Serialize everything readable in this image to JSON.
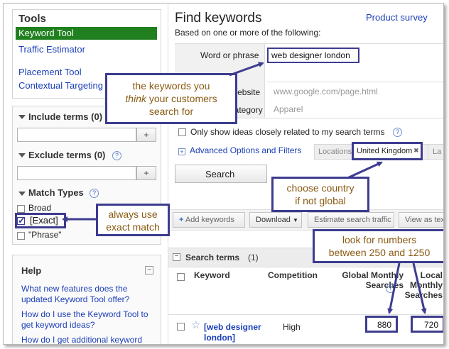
{
  "sidebar": {
    "tools_title": "Tools",
    "items": [
      {
        "label": "Keyword Tool"
      },
      {
        "label": "Traffic Estimator"
      },
      {
        "label": "Placement Tool"
      },
      {
        "label": "Contextual Targeting Tool"
      }
    ],
    "include_terms": "Include terms (0)",
    "exclude_terms": "Exclude terms (0)",
    "match_types": "Match Types",
    "match_options": [
      "Broad",
      "[Exact]",
      "\"Phrase\""
    ],
    "plus": "+",
    "help_title": "Help",
    "help_minus": "−",
    "help_links": [
      "What new features does the updated Keyword Tool offer?",
      "How do I use the Keyword Tool to get keyword ideas?",
      "How do I get additional keyword"
    ]
  },
  "main": {
    "title": "Find keywords",
    "subtitle": "Based on one or more of the following:",
    "product_survey": "Product survey",
    "word_label": "Word or phrase",
    "word_value": "web designer london",
    "website_label": "Website",
    "website_placeholder": "www.google.com/page.html",
    "category_label": "Category",
    "category_value": "Apparel",
    "only_ideas": "Only show ideas closely related to my search terms",
    "advanced": "Advanced Options and Filters",
    "locations": "Locations:",
    "location_chip": "United Kingdom",
    "chip_close": "✖",
    "languages_abbr": "La",
    "search_button": "Search"
  },
  "toolbar": {
    "add_keywords": "Add keywords",
    "download": "Download",
    "estimate": "Estimate search traffic",
    "view_as": "View as text"
  },
  "results": {
    "section_title": "Search terms",
    "section_count": "(1)",
    "columns": [
      "Keyword",
      "Competition",
      "Global Monthly Searches",
      "Local Monthly Searches"
    ],
    "rows": [
      {
        "keyword": "[web designer london]",
        "competition": "High",
        "global": "880",
        "local": "720"
      }
    ]
  },
  "callouts": {
    "think_line1": "the keywords you",
    "think_line2_em": "think",
    "think_line2_rest": "your customers",
    "think_line3": "search for",
    "country_line1": "choose country",
    "country_line2": "if not global",
    "exact_line1": "always use",
    "exact_line2": "exact match",
    "numbers_line1": "look for numbers",
    "numbers_line2": "between 250 and 1250"
  },
  "colors": {
    "selected_bg": "#208020",
    "link": "#1c3fb8",
    "callout_border": "#3d3c8f",
    "callout_text": "#8a5a12"
  }
}
